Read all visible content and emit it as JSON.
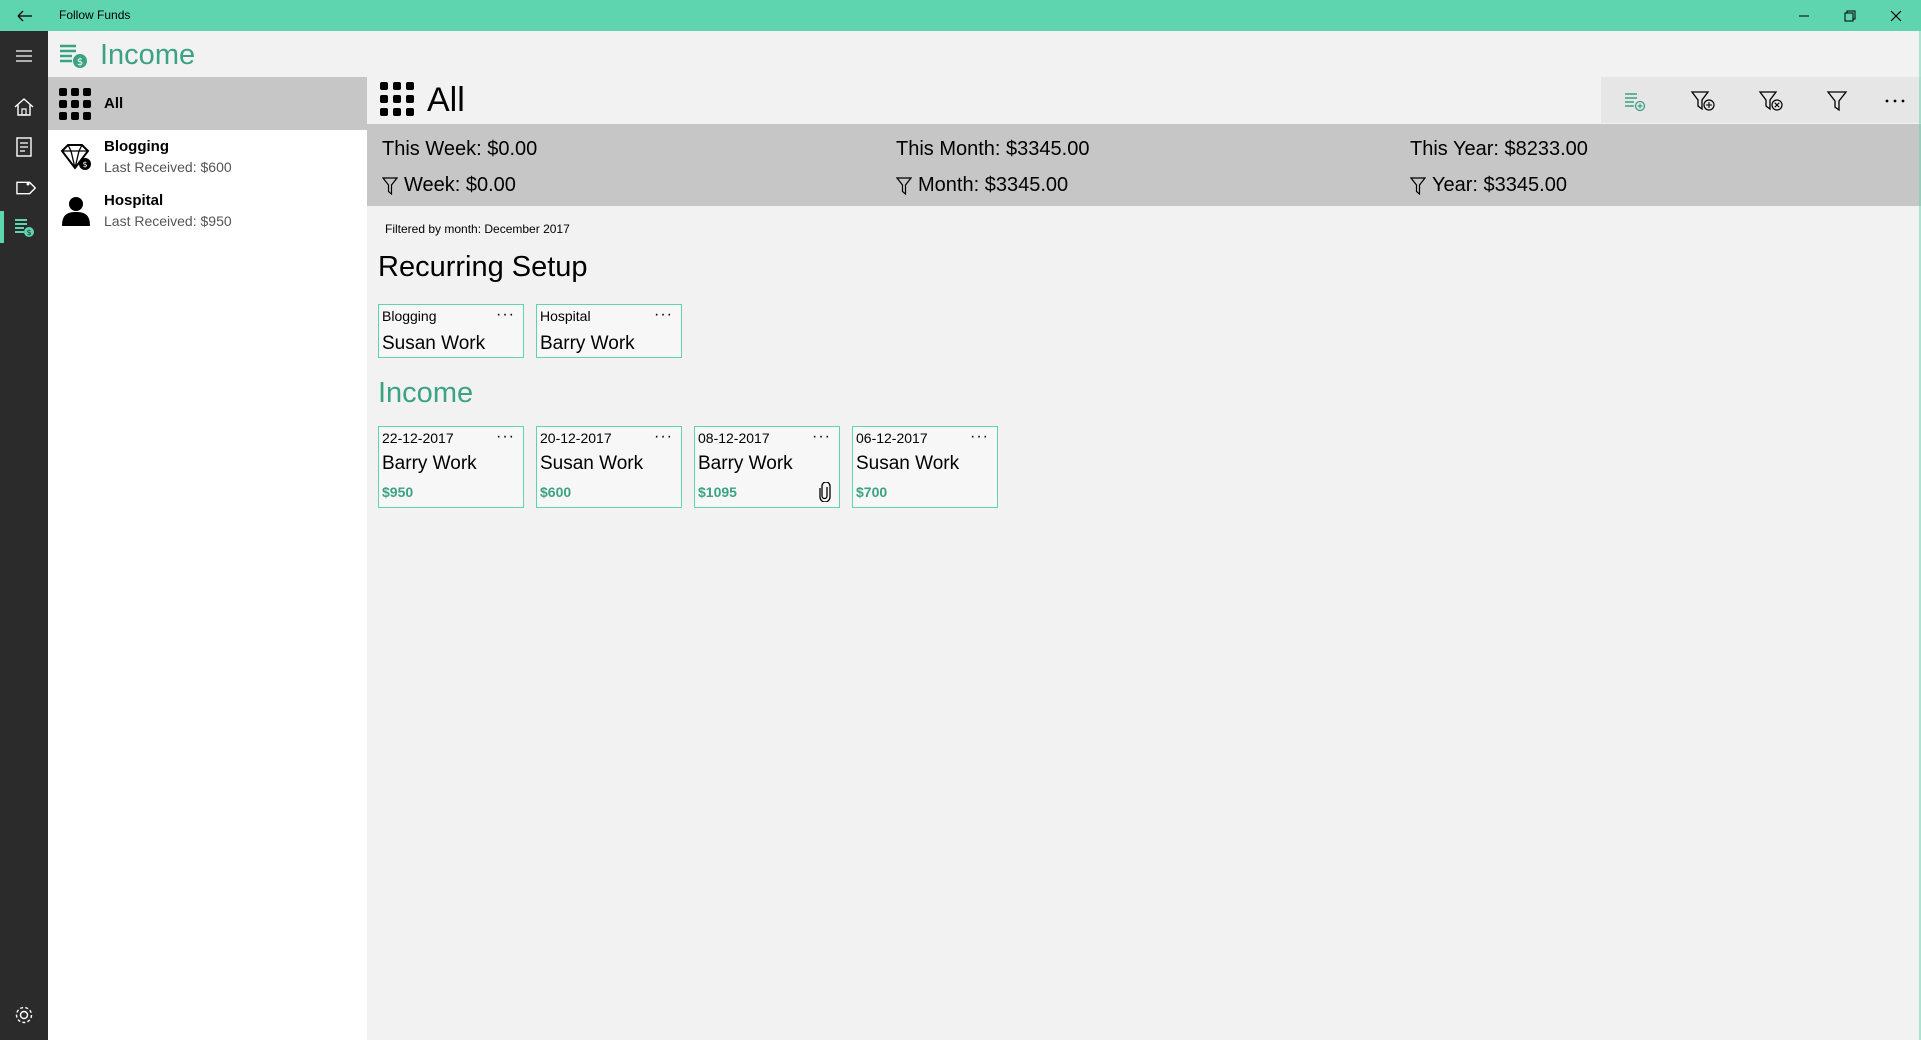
{
  "app": {
    "title": "Follow Funds"
  },
  "colors": {
    "accent": "#5ed5ae",
    "accent_text": "#3ba284",
    "rail": "#2b2b2b",
    "selected": "#c6c6c6"
  },
  "rail": {
    "items": [
      "home-icon",
      "report-icon",
      "tag-icon",
      "income-icon"
    ],
    "bottom": "gear-icon",
    "menu": "hamburger-icon"
  },
  "page": {
    "title": "Income"
  },
  "sidebar": {
    "items": [
      {
        "label": "All",
        "icon": "grid-icon"
      },
      {
        "label": "Blogging",
        "sub": "Last Received: $600",
        "icon": "diamond-icon"
      },
      {
        "label": "Hospital",
        "sub": "Last Received: $950",
        "icon": "person-icon"
      }
    ]
  },
  "main": {
    "title": "All",
    "toolbar": [
      "add-income-icon",
      "filter-add-icon",
      "filter-clear-icon",
      "filter-icon",
      "more-icon"
    ],
    "stats": {
      "this_week": "This Week: $0.00",
      "this_month": "This Month: $3345.00",
      "this_year": "This Year: $8233.00",
      "f_week": "Week: $0.00",
      "f_month": "Month: $3345.00",
      "f_year": "Year: $3345.00"
    },
    "filtered_by": "Filtered by month: December 2017",
    "recurring_title": "Recurring Setup",
    "recurring": [
      {
        "category": "Blogging",
        "name": "Susan Work",
        "dots": "···"
      },
      {
        "category": "Hospital",
        "name": "Barry Work",
        "dots": "···"
      }
    ],
    "income_title": "Income",
    "income": [
      {
        "date": "22-12-2017",
        "name": "Barry Work",
        "amount": "$950",
        "dots": "···"
      },
      {
        "date": "20-12-2017",
        "name": "Susan Work",
        "amount": "$600",
        "dots": "···"
      },
      {
        "date": "08-12-2017",
        "name": "Barry Work",
        "amount": "$1095",
        "dots": "···",
        "attachment": true
      },
      {
        "date": "06-12-2017",
        "name": "Susan Work",
        "amount": "$700",
        "dots": "···"
      }
    ]
  }
}
